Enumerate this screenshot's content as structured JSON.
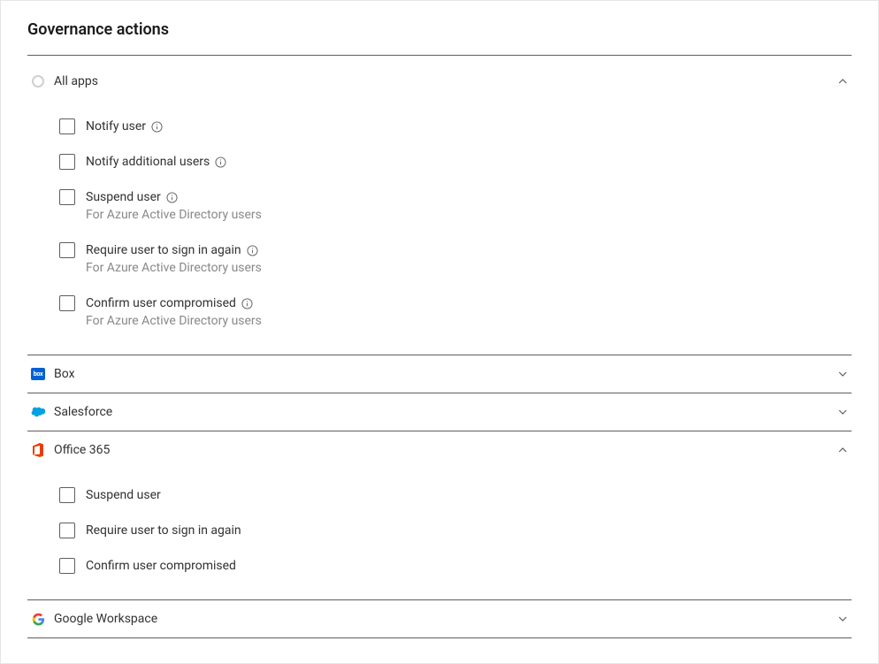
{
  "title": "Governance actions",
  "hint_aad": "For Azure Active Directory users",
  "sections": {
    "allapps": {
      "label": "All apps",
      "expanded": true,
      "actions": [
        {
          "label": "Notify user",
          "info": true
        },
        {
          "label": "Notify additional users",
          "info": true
        },
        {
          "label": "Suspend user",
          "info": true,
          "hint": true
        },
        {
          "label": "Require user to sign in again",
          "info": true,
          "hint": true
        },
        {
          "label": "Confirm user compromised",
          "info": true,
          "hint": true
        }
      ]
    },
    "box": {
      "label": "Box",
      "expanded": false
    },
    "salesforce": {
      "label": "Salesforce",
      "expanded": false
    },
    "office365": {
      "label": "Office 365",
      "expanded": true,
      "actions": [
        {
          "label": "Suspend user"
        },
        {
          "label": "Require user to sign in again"
        },
        {
          "label": "Confirm user compromised"
        }
      ]
    },
    "google": {
      "label": "Google Workspace",
      "expanded": false
    }
  }
}
